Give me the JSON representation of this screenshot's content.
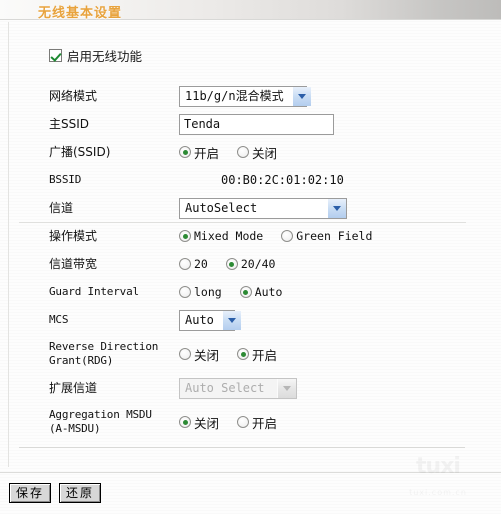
{
  "header": {
    "title": "无线基本设置"
  },
  "enable_wireless": {
    "label": "启用无线功能",
    "checked": true,
    "icon": "checkbox-checked-icon"
  },
  "fields": {
    "network_mode": {
      "label": "网络模式",
      "value": "11b/g/n混合模式",
      "icon": "chevron-down-icon"
    },
    "primary_ssid": {
      "label": "主SSID",
      "value": "Tenda",
      "placeholder": ""
    },
    "broadcast_ssid": {
      "label": "广播(SSID)",
      "options": [
        {
          "label": "开启",
          "selected": true
        },
        {
          "label": "关闭",
          "selected": false
        }
      ]
    },
    "bssid": {
      "label": "BSSID",
      "value": "00:B0:2C:01:02:10"
    },
    "channel": {
      "label": "信道",
      "value": "AutoSelect",
      "icon": "chevron-down-icon"
    },
    "operating_mode": {
      "label": "操作模式",
      "options": [
        {
          "label": "Mixed Mode",
          "selected": true
        },
        {
          "label": "Green Field",
          "selected": false
        }
      ]
    },
    "channel_bandwidth": {
      "label": "信道带宽",
      "options": [
        {
          "label": "20",
          "selected": false
        },
        {
          "label": "20/40",
          "selected": true
        }
      ]
    },
    "guard_interval": {
      "label": "Guard Interval",
      "options": [
        {
          "label": "long",
          "selected": false
        },
        {
          "label": "Auto",
          "selected": true
        }
      ]
    },
    "mcs": {
      "label": "MCS",
      "value": "Auto",
      "icon": "chevron-down-icon"
    },
    "rdg": {
      "label": "Reverse Direction\nGrant(RDG)",
      "options": [
        {
          "label": "关闭",
          "selected": false
        },
        {
          "label": "开启",
          "selected": true
        }
      ]
    },
    "extension_channel": {
      "label": "扩展信道",
      "value": "Auto Select",
      "disabled": true,
      "icon": "chevron-down-icon"
    },
    "amsdu": {
      "label": "Aggregation MSDU\n(A-MSDU)",
      "options": [
        {
          "label": "关闭",
          "selected": true
        },
        {
          "label": "开启",
          "selected": false
        }
      ]
    }
  },
  "footer": {
    "save_label": "保存",
    "reset_label": "还原"
  },
  "watermark": {
    "text": "tuxi",
    "subtext": "tuxi.com.cn"
  },
  "colors": {
    "title": "#e8a33d",
    "radio_selected": "#2c8a34",
    "check": "#1d8a32",
    "dropdown_arrow": "#2b5ea8"
  }
}
